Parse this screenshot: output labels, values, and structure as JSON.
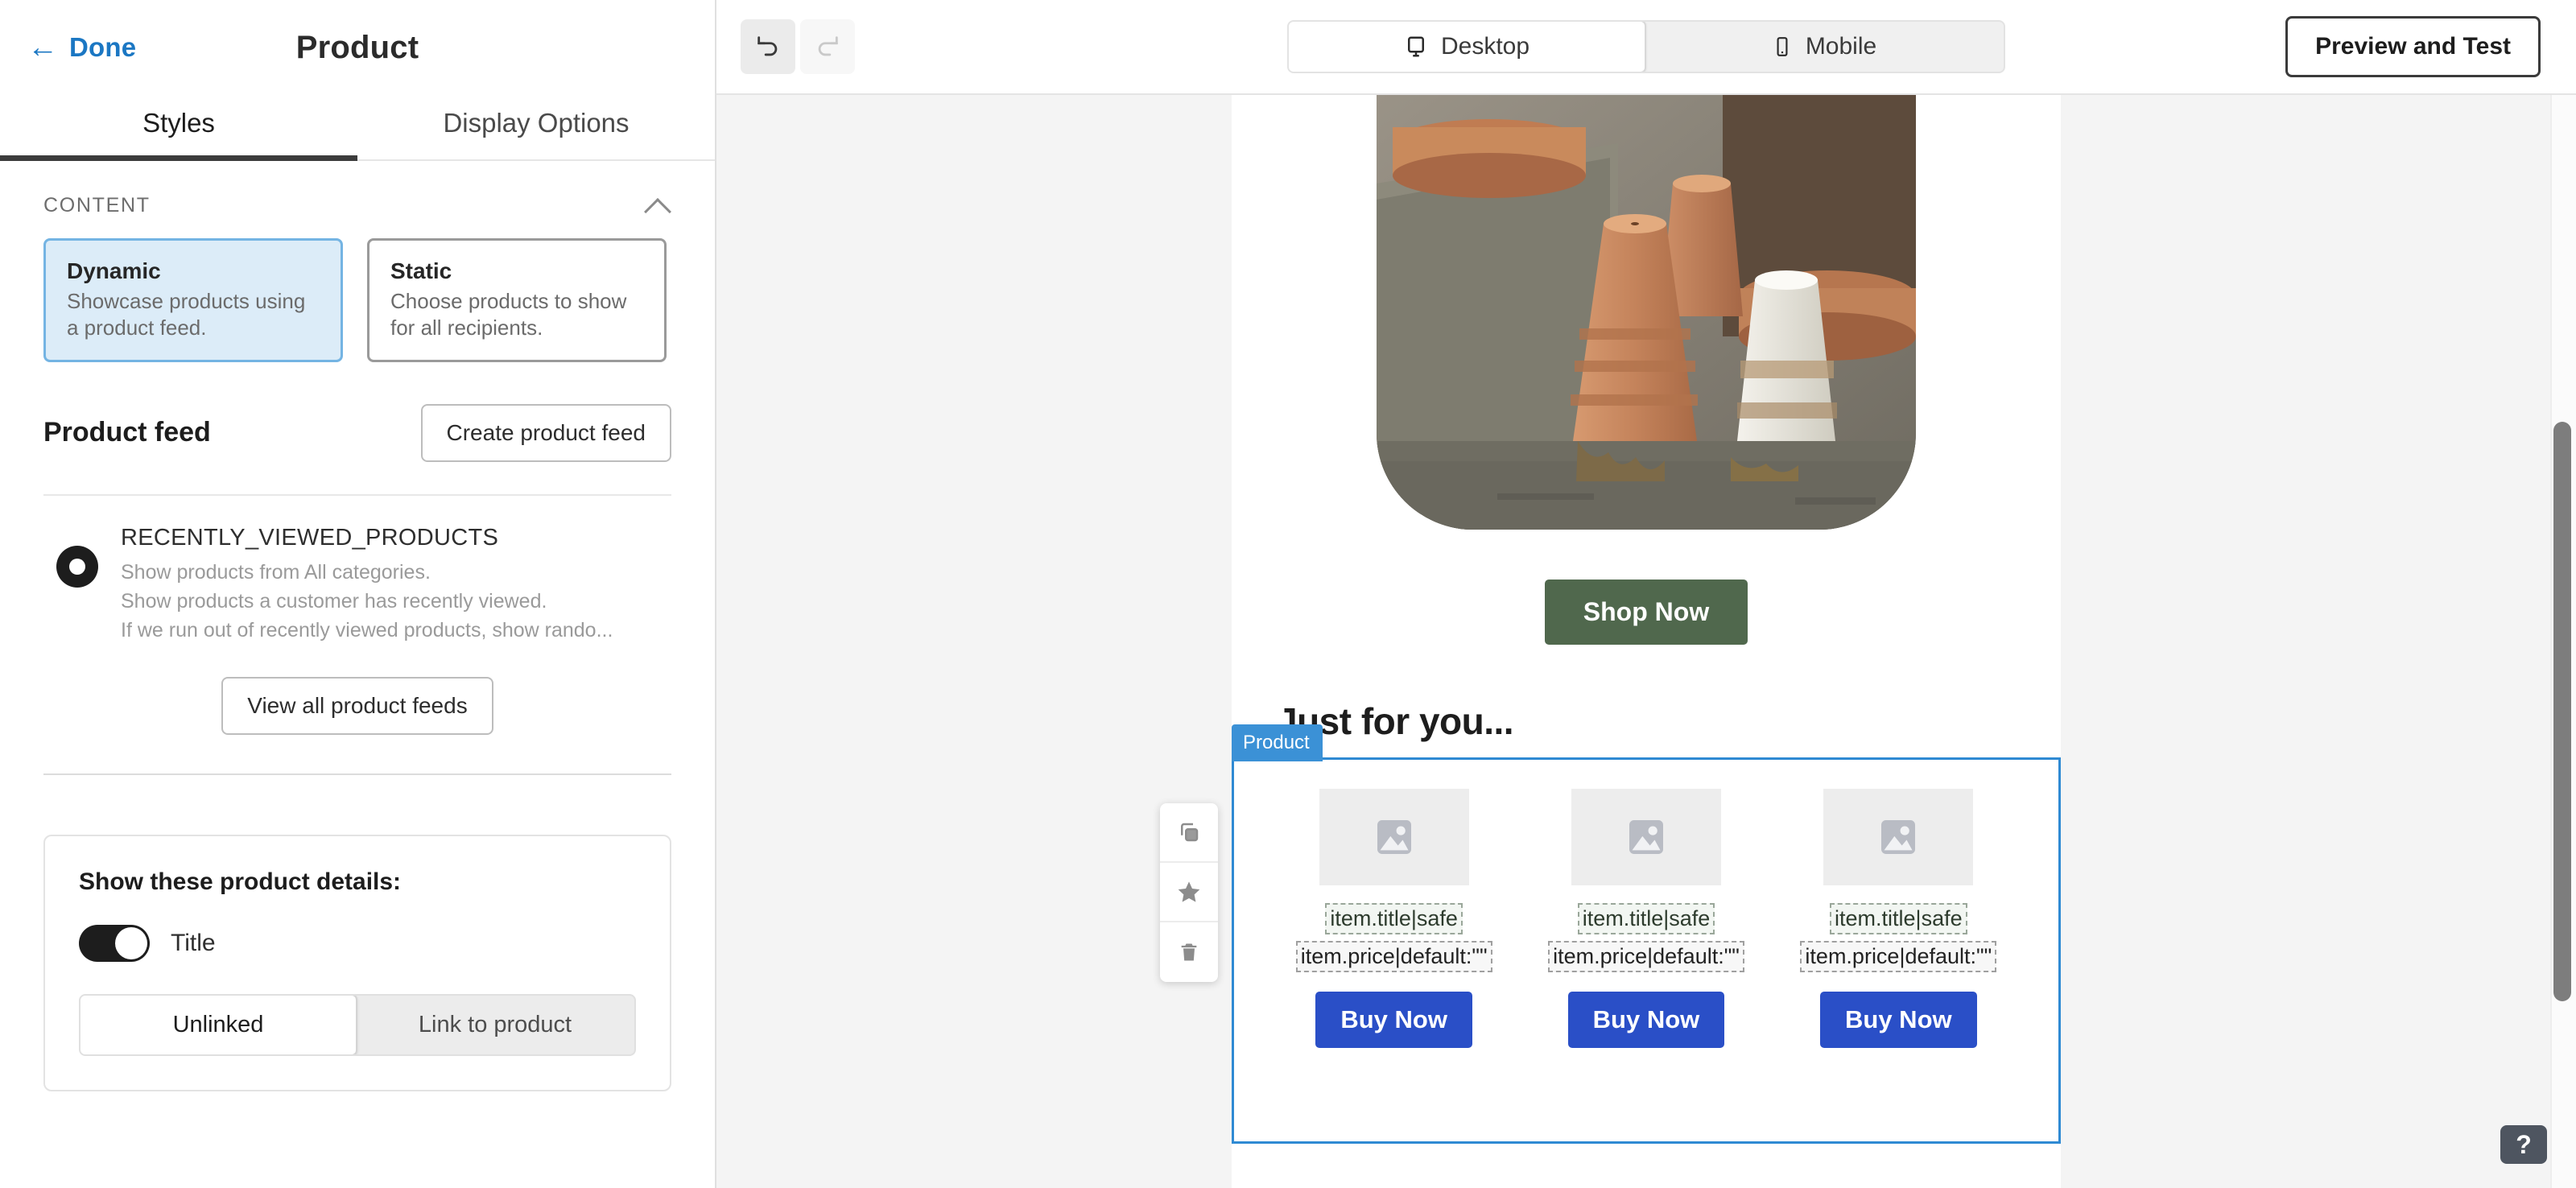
{
  "sidebar": {
    "back_label": "Done",
    "back_icon": "arrow-left-icon",
    "title": "Product",
    "tabs": [
      {
        "label": "Styles",
        "active": true
      },
      {
        "label": "Display Options",
        "active": false
      }
    ],
    "content_section": {
      "title": "CONTENT",
      "collapse_icon": "chevron-up-icon",
      "choices": [
        {
          "title": "Dynamic",
          "desc": "Showcase products using a product feed.",
          "selected": true
        },
        {
          "title": "Static",
          "desc": "Choose products to show for all recipients.",
          "selected": false
        }
      ],
      "feed_label": "Product feed",
      "create_feed_button": "Create product feed",
      "feed_item": {
        "name": "RECENTLY_VIEWED_PRODUCTS",
        "line1": "Show products from All categories.",
        "line2": "Show products a customer has recently viewed.",
        "line3": "If we run out of recently viewed products, show rando...",
        "selected": true
      },
      "view_all_button": "View all product feeds"
    },
    "details_card": {
      "title": "Show these product details:",
      "toggle": {
        "label": "Title",
        "on": true
      },
      "link_modes": [
        {
          "label": "Unlinked",
          "active": true
        },
        {
          "label": "Link to product",
          "active": false
        }
      ]
    }
  },
  "topbar": {
    "undo_icon": "undo-icon",
    "redo_icon": "redo-icon",
    "devices": [
      {
        "label": "Desktop",
        "icon": "monitor-icon",
        "active": true
      },
      {
        "label": "Mobile",
        "icon": "phone-icon",
        "active": false
      }
    ],
    "preview_button": "Preview and Test"
  },
  "canvas": {
    "hero_image_alt": "terracotta-flower-pots-photo",
    "shop_button": "Shop Now",
    "section_heading": "Just for you...",
    "selected_block": {
      "badge": "Product",
      "tools": [
        {
          "icon": "duplicate-icon",
          "name": "duplicate"
        },
        {
          "icon": "star-icon",
          "name": "favorite"
        },
        {
          "icon": "trash-icon",
          "name": "delete"
        }
      ],
      "items": [
        {
          "image_icon": "image-placeholder-icon",
          "title_tag": "item.title|safe",
          "price_tag": "item.price|default:\"\"",
          "button": "Buy Now"
        },
        {
          "image_icon": "image-placeholder-icon",
          "title_tag": "item.title|safe",
          "price_tag": "item.price|default:\"\"",
          "button": "Buy Now"
        },
        {
          "image_icon": "image-placeholder-icon",
          "title_tag": "item.title|safe",
          "price_tag": "item.price|default:\"\"",
          "button": "Buy Now"
        }
      ]
    },
    "scrollbar": {
      "name": "vertical-scrollbar"
    },
    "help_button": "?"
  },
  "colors": {
    "link_blue": "#1b77c3",
    "selection_blue": "#2f8ad3",
    "badge_blue": "#3b91d6",
    "buy_blue": "#2a4fc7",
    "shop_green": "#50684d",
    "selected_card_bg": "#dcecf8"
  }
}
